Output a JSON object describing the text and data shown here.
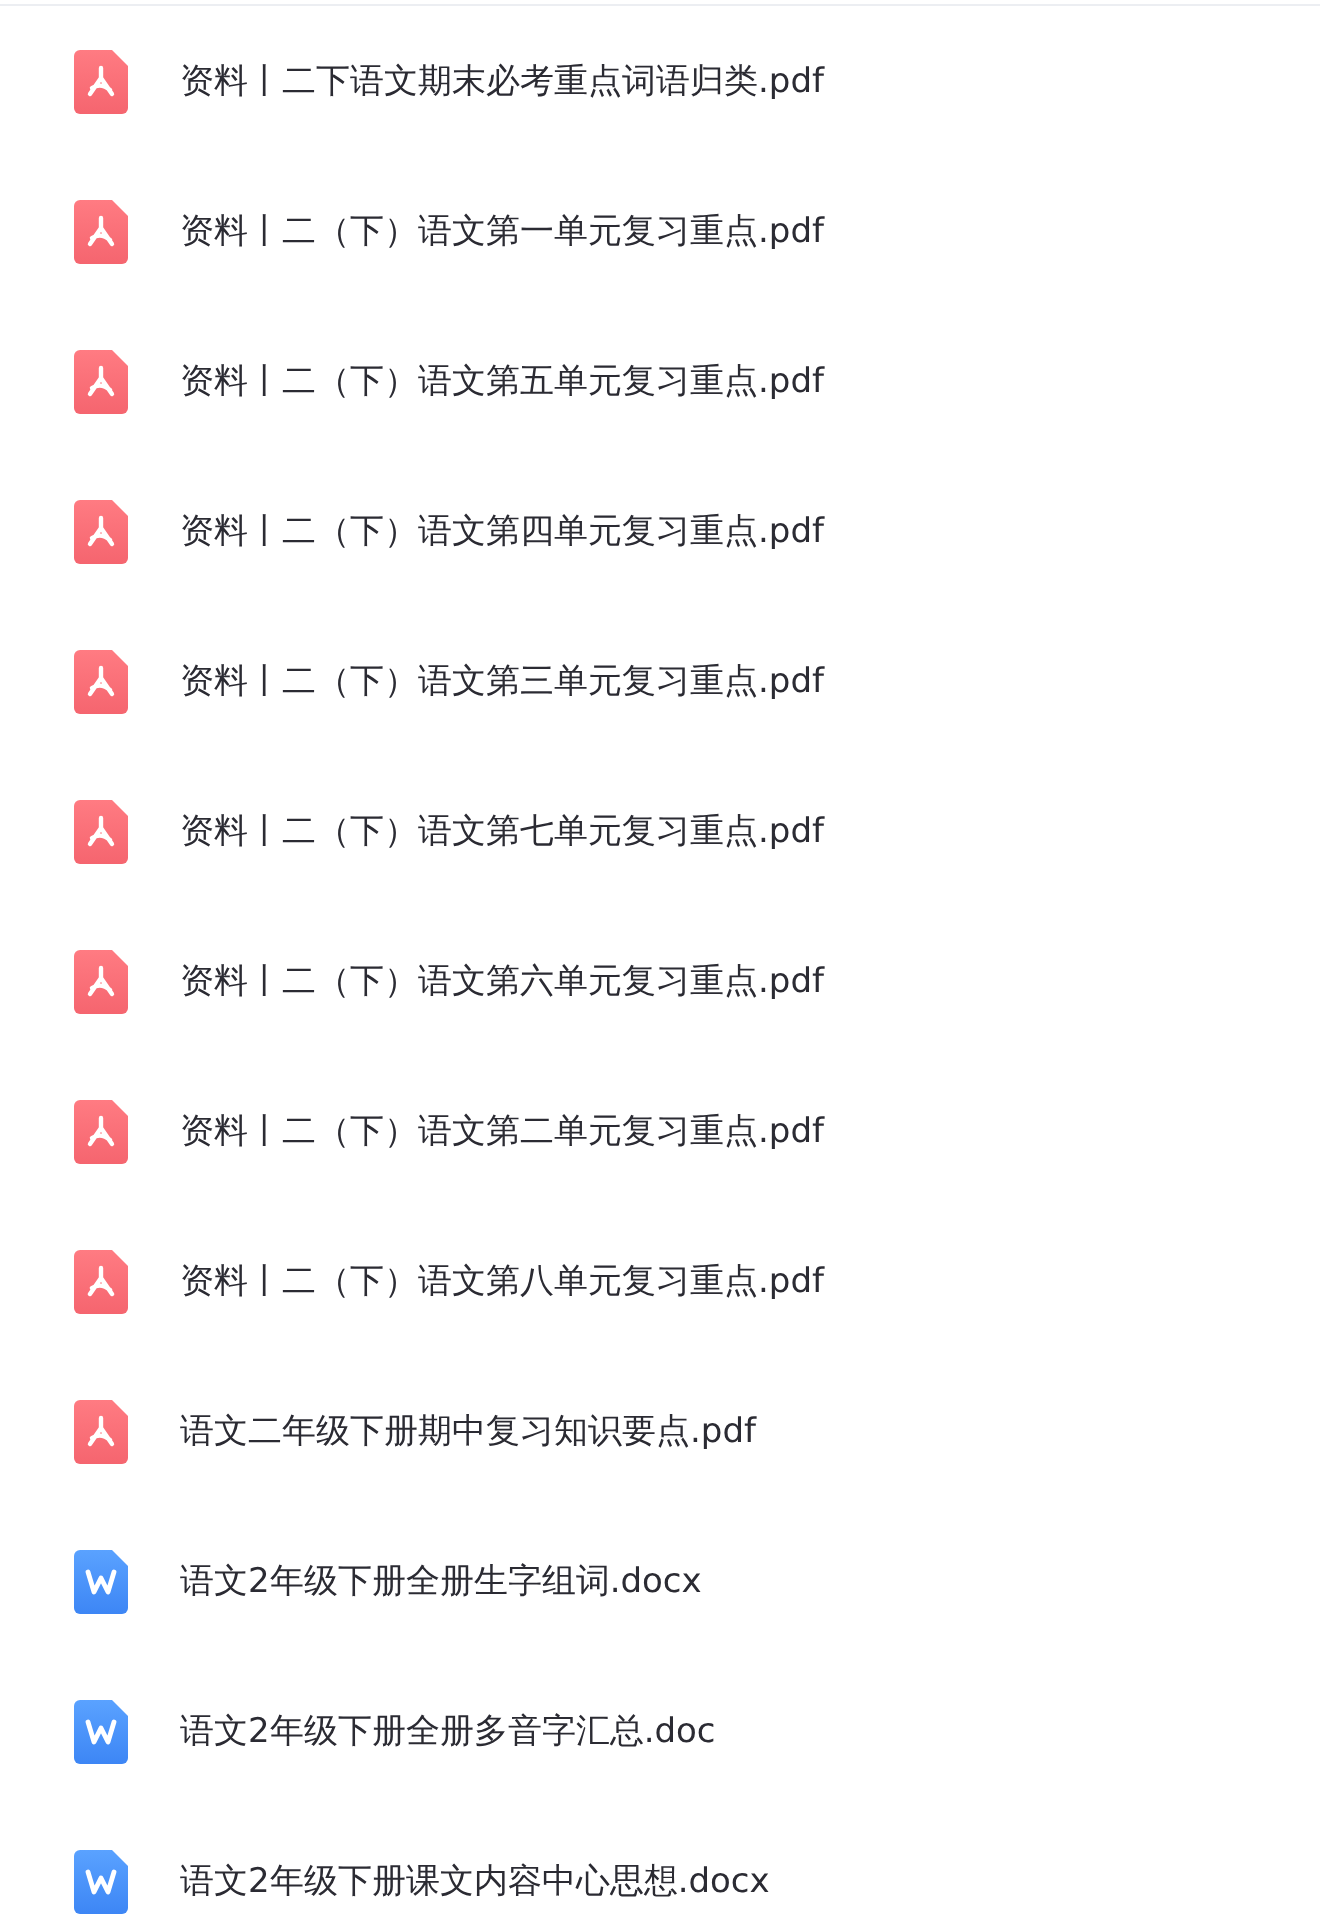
{
  "files": [
    {
      "kind": "pdf",
      "name": "资料丨二下语文期末必考重点词语归类.pdf"
    },
    {
      "kind": "pdf",
      "name": "资料丨二（下）语文第一单元复习重点.pdf"
    },
    {
      "kind": "pdf",
      "name": "资料丨二（下）语文第五单元复习重点.pdf"
    },
    {
      "kind": "pdf",
      "name": "资料丨二（下）语文第四单元复习重点.pdf"
    },
    {
      "kind": "pdf",
      "name": "资料丨二（下）语文第三单元复习重点.pdf"
    },
    {
      "kind": "pdf",
      "name": "资料丨二（下）语文第七单元复习重点.pdf"
    },
    {
      "kind": "pdf",
      "name": "资料丨二（下）语文第六单元复习重点.pdf"
    },
    {
      "kind": "pdf",
      "name": "资料丨二（下）语文第二单元复习重点.pdf"
    },
    {
      "kind": "pdf",
      "name": "资料丨二（下）语文第八单元复习重点.pdf"
    },
    {
      "kind": "pdf",
      "name": "语文二年级下册期中复习知识要点.pdf"
    },
    {
      "kind": "word",
      "name": "语文2年级下册全册生字组词.docx"
    },
    {
      "kind": "word",
      "name": "语文2年级下册全册多音字汇总.doc"
    },
    {
      "kind": "word",
      "name": "语文2年级下册课文内容中心思想.docx"
    }
  ]
}
